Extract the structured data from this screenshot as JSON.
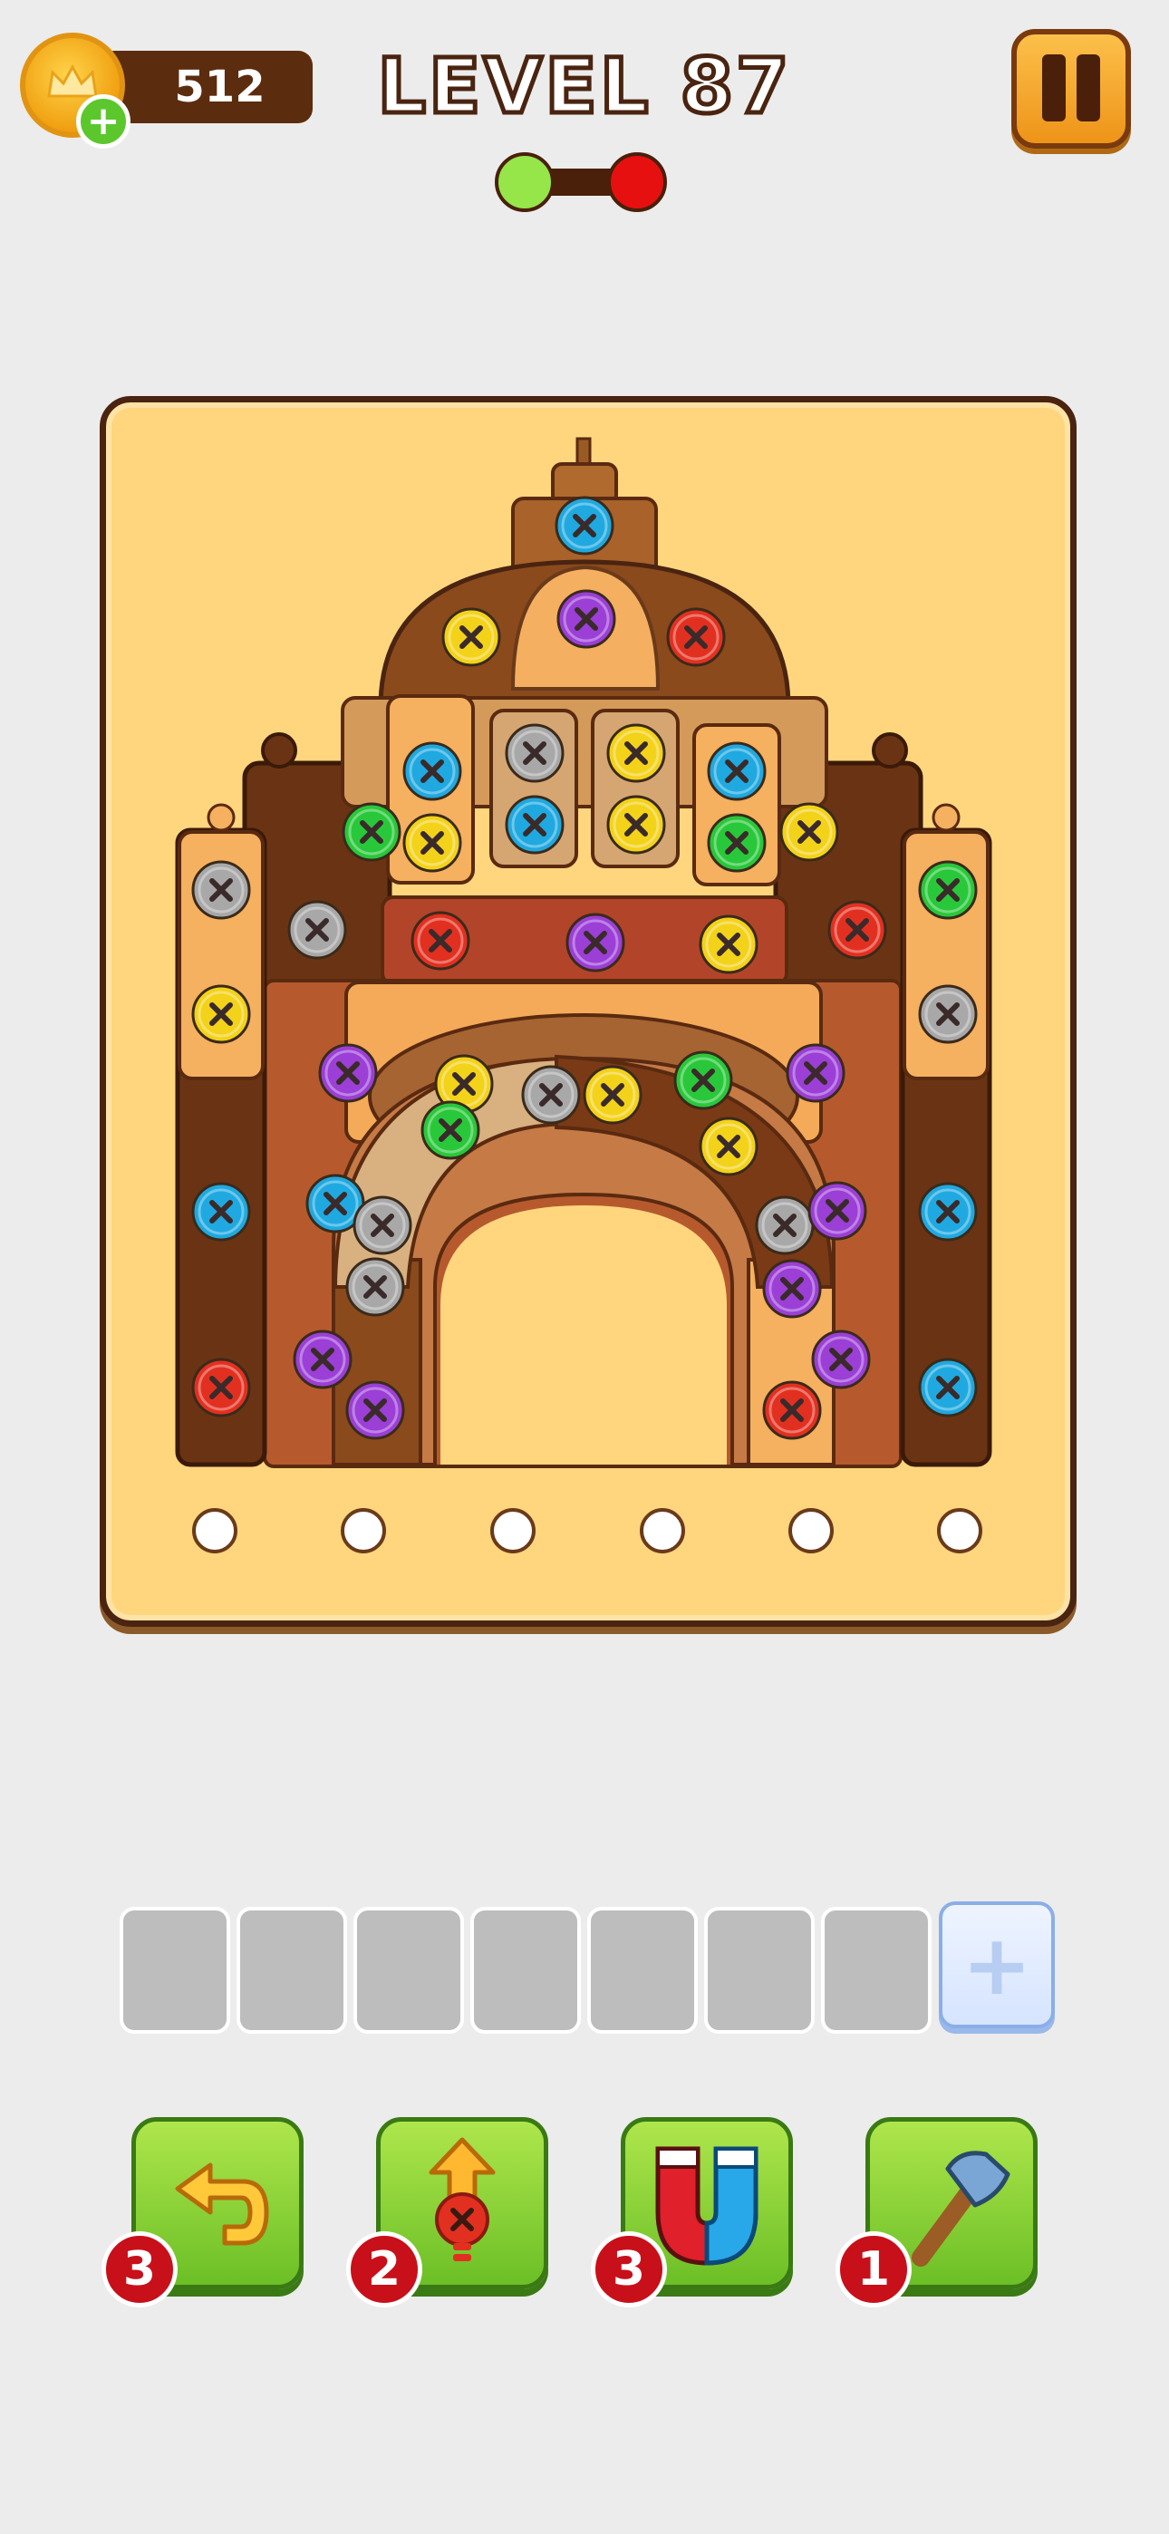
{
  "hud": {
    "coins": "512",
    "level_label": "LEVEL 87",
    "add_coins_symbol": "+",
    "progress_start_color": "#96e64a",
    "progress_end_color": "#e61010"
  },
  "board": {
    "background_color": "#ffd67e",
    "structure": "wooden palace with domed roof",
    "screw_colors": {
      "blue": "#1fa9e0",
      "gray": "#a8a8a8",
      "yellow": "#f3d21a",
      "red": "#e23020",
      "purple": "#9b3fd6",
      "green": "#29c83a"
    },
    "empty_holes_count": 6
  },
  "tray": {
    "empty_slots_count": 7,
    "add_slot_symbol": "+"
  },
  "boosters": [
    {
      "name": "undo",
      "icon": "undo-arrow-icon",
      "count": "3"
    },
    {
      "name": "remove-screw",
      "icon": "screw-up-arrow-icon",
      "count": "2"
    },
    {
      "name": "magnet",
      "icon": "magnet-icon",
      "count": "3"
    },
    {
      "name": "hammer",
      "icon": "hammer-icon",
      "count": "1"
    }
  ]
}
